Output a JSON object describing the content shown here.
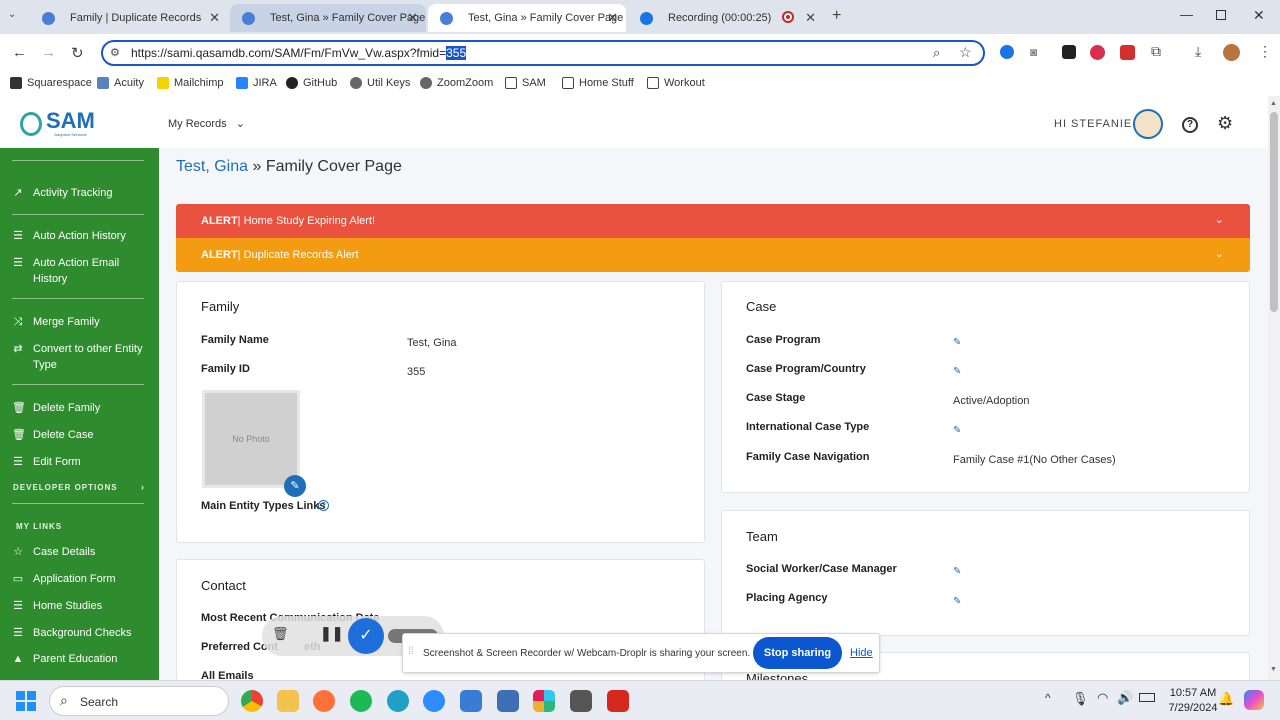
{
  "browser": {
    "tabs": [
      {
        "label": "Family | Duplicate Records",
        "state": "inactive"
      },
      {
        "label": "Test, Gina » Family Cover Page",
        "state": "hover"
      },
      {
        "label": "Test, Gina » Family Cover Page",
        "state": "active"
      },
      {
        "label": "Recording (00:00:25)",
        "state": "inactive"
      }
    ],
    "url_prefix": "https://sami.qasamdb.com/SAM/Fm/FmVw_Vw.aspx?fmid=",
    "url_selected": "355",
    "bookmarks": [
      "Squarespace",
      "Acuity",
      "Mailchimp",
      "JIRA",
      "GitHub",
      "Util Keys",
      "ZoomZoom",
      "SAM",
      "Home Stuff",
      "Workout"
    ]
  },
  "app": {
    "logo_text": "SAM",
    "logo_sub": "Adoption Services",
    "my_records": "My Records",
    "greeting": "HI STEFANIE",
    "accent": "#2e8b2e"
  },
  "sidebar": {
    "items": [
      {
        "label": "Activity Tracking",
        "icon": "chart-line-icon"
      },
      {
        "label": "Auto Action History",
        "icon": "list-icon"
      },
      {
        "label": "Auto Action Email History",
        "icon": "list-icon"
      },
      {
        "label": "Merge Family",
        "icon": "merge-icon"
      },
      {
        "label": "Convert to other Entity Type",
        "icon": "convert-icon"
      },
      {
        "label": "Delete Family",
        "icon": "trash-icon"
      },
      {
        "label": "Delete Case",
        "icon": "trash-icon"
      },
      {
        "label": "Edit Form",
        "icon": "list-icon"
      }
    ],
    "developer_options": "DEVELOPER OPTIONS",
    "my_links_heading": "MY LINKS",
    "links": [
      {
        "label": "Case Details",
        "icon": "star-icon"
      },
      {
        "label": "Application Form",
        "icon": "folder-icon"
      },
      {
        "label": "Home Studies",
        "icon": "list-icon"
      },
      {
        "label": "Background Checks",
        "icon": "list-icon"
      },
      {
        "label": "Parent Education",
        "icon": "graduation-icon"
      }
    ]
  },
  "breadcrumb": {
    "name": "Test, Gina",
    "sep": " » ",
    "page": "Family Cover Page"
  },
  "alerts": [
    {
      "tag": "ALERT",
      "text": " | Home Study Expiring Alert!",
      "color": "#e8523f"
    },
    {
      "tag": "ALERT",
      "text": " | Duplicate Records Alert",
      "color": "#f39c12"
    }
  ],
  "family": {
    "title": "Family",
    "name_label": "Family Name",
    "name_value": "Test, Gina",
    "id_label": "Family ID",
    "id_value": "355",
    "photo_placeholder": "No Photo",
    "links_label": "Main Entity Types Links"
  },
  "case": {
    "title": "Case",
    "rows": [
      {
        "label": "Case Program",
        "value": ""
      },
      {
        "label": "Case Program/Country",
        "value": ""
      },
      {
        "label": "Case Stage",
        "value": "Active/Adoption"
      },
      {
        "label": "International Case Type",
        "value": ""
      },
      {
        "label": "Family Case Navigation",
        "value": "Family Case #1(No Other Cases)"
      }
    ]
  },
  "team": {
    "title": "Team",
    "rows": [
      {
        "label": "Social Worker/Case Manager"
      },
      {
        "label": "Placing Agency"
      }
    ]
  },
  "milestones": {
    "title": "Milestones"
  },
  "contact": {
    "title": "Contact",
    "rows": [
      "Most Recent Communication Date",
      "Preferred Cont",
      "All Emails"
    ],
    "preferred_tail": "eth"
  },
  "sharing": {
    "text": "Screenshot & Screen Recorder w/ Webcam-Droplr is sharing your screen.",
    "stop": "Stop sharing",
    "hide": "Hide"
  },
  "taskbar": {
    "search": "Search",
    "time": "10:57 AM",
    "date": "7/29/2024"
  }
}
